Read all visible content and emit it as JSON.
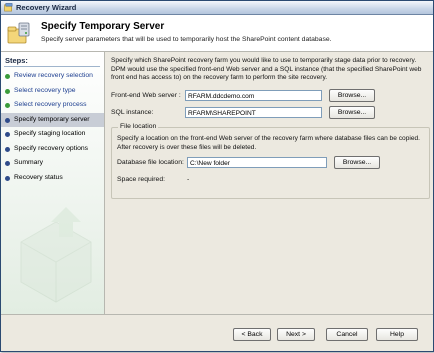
{
  "window": {
    "title": "Recovery Wizard",
    "icon": "wizard-app-icon"
  },
  "header": {
    "title": "Specify Temporary Server",
    "subtitle": "Specify server parameters that will be used to temporarily host the SharePoint content database.",
    "icon": "server-folder-icon"
  },
  "steps": {
    "heading": "Steps:",
    "items": [
      {
        "label": "Review recovery selection",
        "state": "done"
      },
      {
        "label": "Select recovery type",
        "state": "done"
      },
      {
        "label": "Select recovery process",
        "state": "done"
      },
      {
        "label": "Specify temporary server",
        "state": "current"
      },
      {
        "label": "Specify staging location",
        "state": "pending"
      },
      {
        "label": "Specify recovery options",
        "state": "pending"
      },
      {
        "label": "Summary",
        "state": "pending"
      },
      {
        "label": "Recovery status",
        "state": "pending"
      }
    ]
  },
  "main": {
    "intro": "Specify which SharePoint recovery farm you would like to use to temporarily stage data prior to recovery. DPM would use the specified front-end Web server and a SQL instance (that the specified SharePoint web front end has access to) on the recovery farm to perform the site recovery.",
    "frontend": {
      "label": "Front-end Web server :",
      "value": "RFARM.ddcdemo.com",
      "browse": "Browse..."
    },
    "sql": {
      "label": "SQL instance:",
      "value": "RFARM\\SHAREPOINT",
      "browse": "Browse..."
    },
    "file_location": {
      "legend": "File location",
      "description": "Specify a location on the front-end Web server of the recovery farm where database files can be copied. After recovery is over these files will be deleted.",
      "db_label": "Database file location:",
      "db_value": "C:\\New folder",
      "browse": "Browse...",
      "space_label": "Space required:",
      "space_value": "-"
    }
  },
  "footer": {
    "back": "< Back",
    "next": "Next >",
    "cancel": "Cancel",
    "help": "Help"
  },
  "colors": {
    "window_bg": "#ece9e0",
    "done_bullet": "#3a9b3a",
    "current_bullet": "#2f4b8a",
    "link_text": "#1b3d8f",
    "current_highlight": "#c8cdd6"
  }
}
